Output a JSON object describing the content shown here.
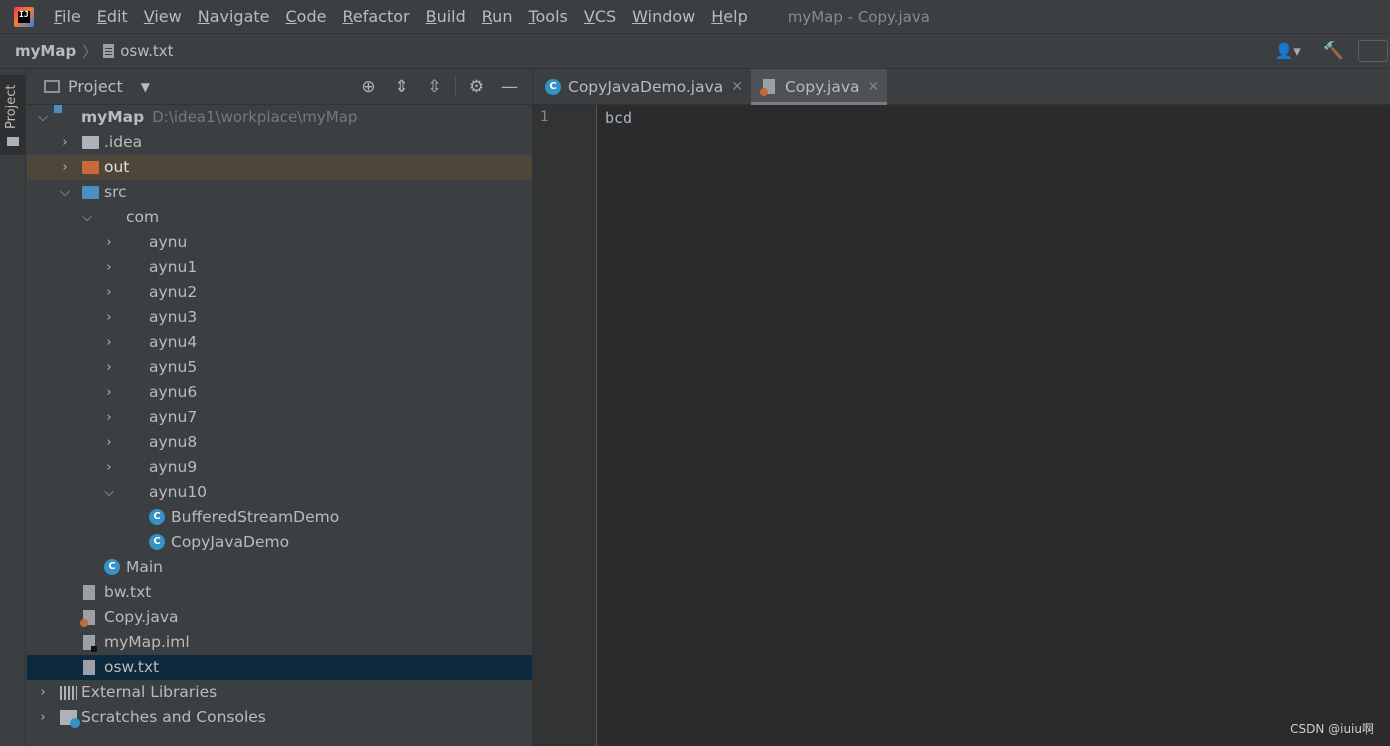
{
  "menubar": {
    "items": [
      "File",
      "Edit",
      "View",
      "Navigate",
      "Code",
      "Refactor",
      "Build",
      "Run",
      "Tools",
      "VCS",
      "Window",
      "Help"
    ],
    "window_title": "myMap - Copy.java"
  },
  "navbar": {
    "root": "myMap",
    "file": "osw.txt"
  },
  "stripe": {
    "project_label": "Project"
  },
  "project_panel": {
    "title": "Project",
    "root": {
      "name": "myMap",
      "path": "D:\\idea1\\workplace\\myMap"
    },
    "idea": ".idea",
    "out": "out",
    "src": "src",
    "com": "com",
    "packages": [
      "aynu",
      "aynu1",
      "aynu2",
      "aynu3",
      "aynu4",
      "aynu5",
      "aynu6",
      "aynu7",
      "aynu8",
      "aynu9",
      "aynu10"
    ],
    "aynu10_classes": [
      "BufferedStreamDemo",
      "CopyJavaDemo"
    ],
    "main": "Main",
    "files": [
      "bw.txt",
      "Copy.java",
      "myMap.iml",
      "osw.txt"
    ],
    "external_libraries": "External Libraries",
    "scratches": "Scratches and Consoles"
  },
  "editor": {
    "tabs": [
      {
        "label": "CopyJavaDemo.java",
        "active": false
      },
      {
        "label": "Copy.java",
        "active": true
      }
    ],
    "line_number": "1",
    "code": "bcd"
  },
  "watermark": "CSDN @iuiu啊",
  "colors": {
    "background": "#3c3f41",
    "editor": "#2b2b2b",
    "selection": "#0d293e",
    "accent": "#3592c4"
  }
}
